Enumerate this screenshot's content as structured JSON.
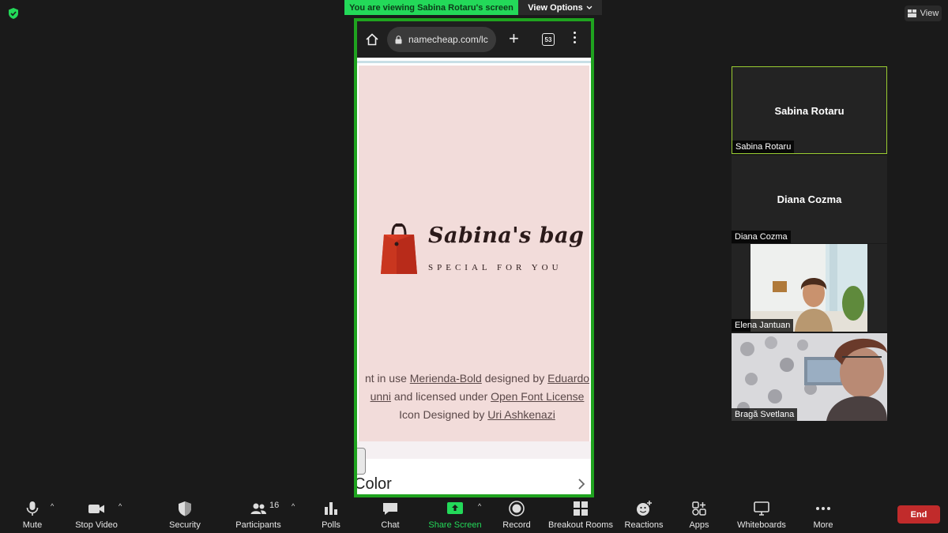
{
  "topbar": {
    "banner_text": "You are viewing Sabina Rotaru's screen",
    "view_options_label": "View Options",
    "view_label": "View"
  },
  "shared_screen": {
    "url": "namecheap.com/lc",
    "tab_count": "53",
    "logo": {
      "title": "Sabina's bag",
      "subtitle": "SPECIAL FOR YOU"
    },
    "credit": {
      "line1_prefix": "nt in use ",
      "font_name": "Merienda-Bold",
      "line1_mid": " designed by ",
      "designer_a": "Eduardo",
      "designer_b": "unni",
      "line2_mid": " and licensed under ",
      "license": "Open Font License",
      "line3_prefix": "Icon Designed by ",
      "icon_author": "Uri Ashkenazi"
    },
    "section_label": "Color"
  },
  "participants_panel": [
    {
      "big_name": "Sabina Rotaru",
      "tag": "Sabina Rotaru",
      "video": false,
      "active": true
    },
    {
      "big_name": "Diana Cozma",
      "tag": "Diana Cozma",
      "video": false,
      "active": false
    },
    {
      "big_name": "",
      "tag": "Elena Jantuan",
      "video": true,
      "active": false
    },
    {
      "big_name": "",
      "tag": "Bragă Svetlana",
      "video": true,
      "active": false
    }
  ],
  "toolbar": {
    "mute": "Mute",
    "stop_video": "Stop Video",
    "security": "Security",
    "participants": "Participants",
    "participants_count": "16",
    "polls": "Polls",
    "chat": "Chat",
    "share_screen": "Share Screen",
    "record": "Record",
    "breakout_rooms": "Breakout Rooms",
    "reactions": "Reactions",
    "apps": "Apps",
    "whiteboards": "Whiteboards",
    "more": "More",
    "end": "End"
  },
  "colors": {
    "banner_green": "#23d959",
    "share_border": "#1fa31f",
    "share_screen_icon": "#23d959",
    "end_red": "#c12b2b",
    "pink_bg": "#f2dcda"
  }
}
